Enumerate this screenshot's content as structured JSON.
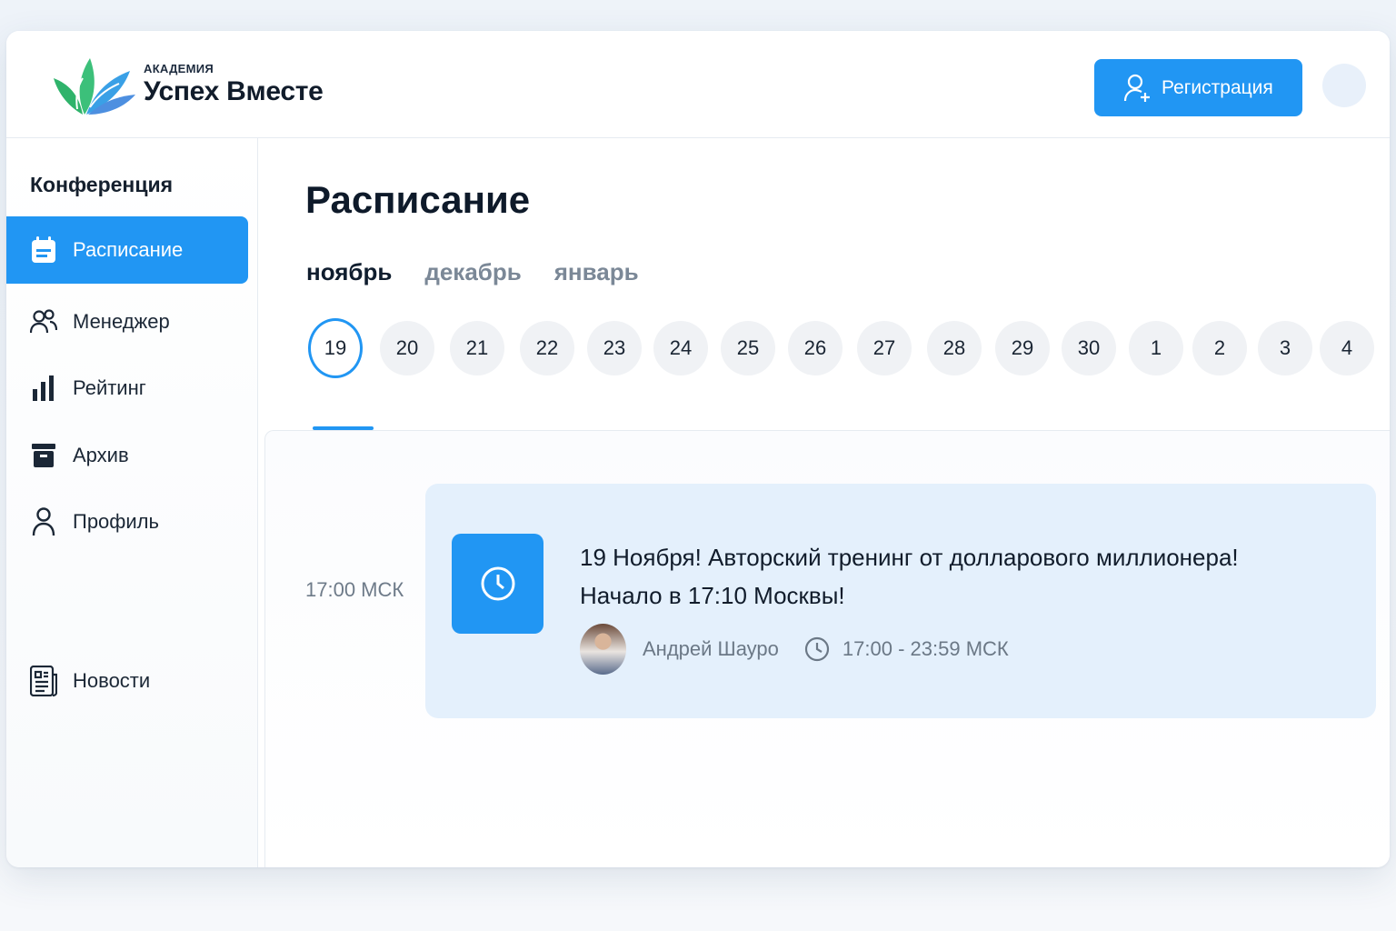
{
  "header": {
    "brand_small": "АКАДЕМИЯ",
    "brand_big": "Успех Вместе",
    "register_label": "Регистрация",
    "logo_icon": "leaf-logo-icon"
  },
  "sidebar": {
    "title": "Конференция",
    "items": [
      {
        "label": "Расписание",
        "icon": "calendar-icon",
        "active": true
      },
      {
        "label": "Менеджер",
        "icon": "users-icon"
      },
      {
        "label": "Рейтинг",
        "icon": "bar-chart-icon"
      },
      {
        "label": "Архив",
        "icon": "archive-icon"
      },
      {
        "label": "Профиль",
        "icon": "user-icon"
      },
      {
        "label": "Новости",
        "icon": "newspaper-icon"
      }
    ]
  },
  "main": {
    "title": "Расписание",
    "months": [
      "ноябрь",
      "декабрь",
      "январь"
    ],
    "active_month": "ноябрь",
    "days": [
      "19",
      "20",
      "21",
      "22",
      "23",
      "24",
      "25",
      "26",
      "27",
      "28",
      "29",
      "30",
      "1",
      "2",
      "3",
      "4"
    ],
    "active_day": "19",
    "event": {
      "time_label": "17:00 МСК",
      "title_line1": "19 Ноября! Авторский тренинг от долларового миллионера!",
      "title_line2": "Начало в 17:10 Москвы!",
      "speaker": "Андрей Шауро",
      "time_range": "17:00 - 23:59 МСК"
    }
  },
  "colors": {
    "accent": "#2196f3",
    "card_bg": "#e4f0fc",
    "text": "#111c2b",
    "muted": "#6b7886"
  }
}
